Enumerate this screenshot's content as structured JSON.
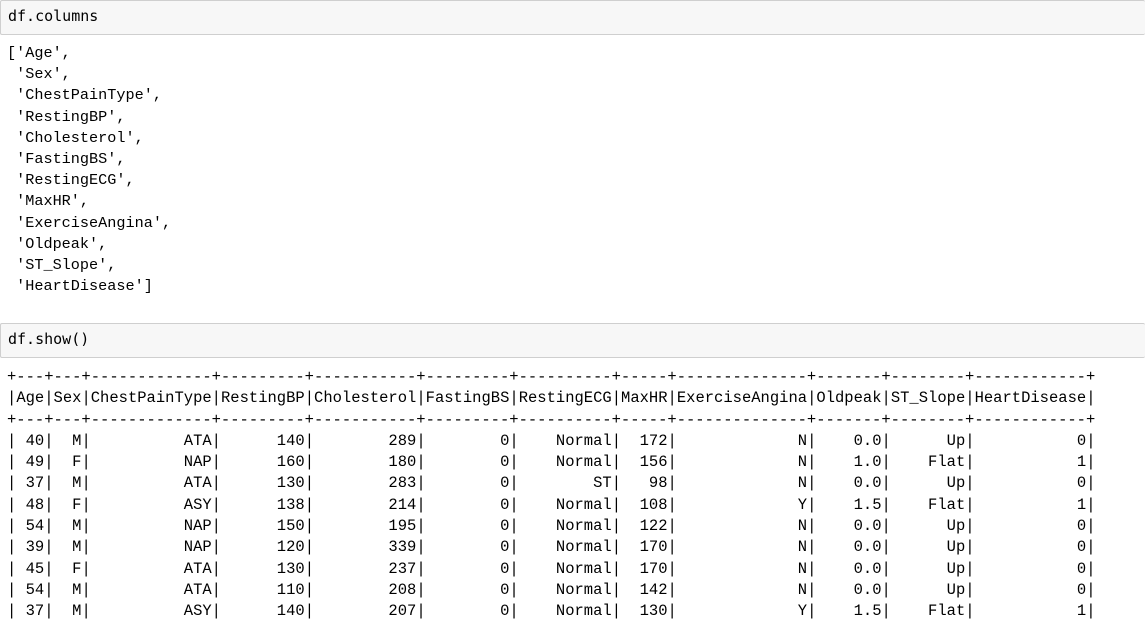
{
  "cells": [
    {
      "input": "df.columns",
      "output_lines": [
        "['Age',",
        " 'Sex',",
        " 'ChestPainType',",
        " 'RestingBP',",
        " 'Cholesterol',",
        " 'FastingBS',",
        " 'RestingECG',",
        " 'MaxHR',",
        " 'ExerciseAngina',",
        " 'Oldpeak',",
        " 'ST_Slope',",
        " 'HeartDisease']"
      ]
    },
    {
      "input": "df.show()",
      "table": {
        "border": "+---+---+-------------+---------+-----------+---------+----------+-----+--------------+-------+--------+------------+",
        "columns": [
          "Age",
          "Sex",
          "ChestPainType",
          "RestingBP",
          "Cholesterol",
          "FastingBS",
          "RestingECG",
          "MaxHR",
          "ExerciseAngina",
          "Oldpeak",
          "ST_Slope",
          "HeartDisease"
        ],
        "rows": [
          [
            "40",
            "M",
            "ATA",
            "140",
            "289",
            "0",
            "Normal",
            "172",
            "N",
            "0.0",
            "Up",
            "0"
          ],
          [
            "49",
            "F",
            "NAP",
            "160",
            "180",
            "0",
            "Normal",
            "156",
            "N",
            "1.0",
            "Flat",
            "1"
          ],
          [
            "37",
            "M",
            "ATA",
            "130",
            "283",
            "0",
            "ST",
            "98",
            "N",
            "0.0",
            "Up",
            "0"
          ],
          [
            "48",
            "F",
            "ASY",
            "138",
            "214",
            "0",
            "Normal",
            "108",
            "Y",
            "1.5",
            "Flat",
            "1"
          ],
          [
            "54",
            "M",
            "NAP",
            "150",
            "195",
            "0",
            "Normal",
            "122",
            "N",
            "0.0",
            "Up",
            "0"
          ],
          [
            "39",
            "M",
            "NAP",
            "120",
            "339",
            "0",
            "Normal",
            "170",
            "N",
            "0.0",
            "Up",
            "0"
          ],
          [
            "45",
            "F",
            "ATA",
            "130",
            "237",
            "0",
            "Normal",
            "170",
            "N",
            "0.0",
            "Up",
            "0"
          ],
          [
            "54",
            "M",
            "ATA",
            "110",
            "208",
            "0",
            "Normal",
            "142",
            "N",
            "0.0",
            "Up",
            "0"
          ],
          [
            "37",
            "M",
            "ASY",
            "140",
            "207",
            "0",
            "Normal",
            "130",
            "Y",
            "1.5",
            "Flat",
            "1"
          ]
        ]
      }
    }
  ]
}
